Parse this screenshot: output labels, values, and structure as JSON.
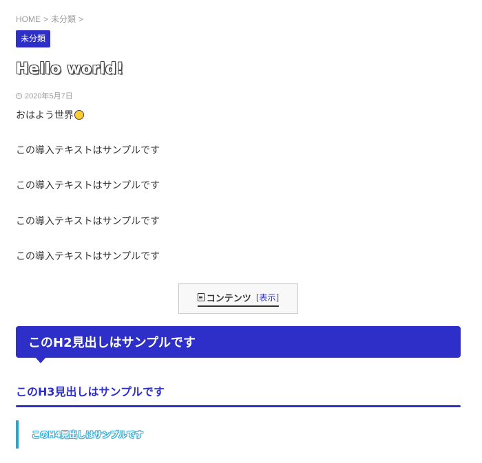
{
  "breadcrumb": {
    "home": "HOME",
    "sep1": ">",
    "category": "未分類",
    "sep2": ">"
  },
  "category_label": "未分類",
  "post": {
    "title": "Hello world!",
    "date": "2020年5月7日",
    "greeting": "おはよう世界",
    "paragraphs": [
      "この導入テキストはサンプルです",
      "この導入テキストはサンプルです",
      "この導入テキストはサンプルです",
      "この導入テキストはサンプルです"
    ]
  },
  "toc": {
    "title": "コンテンツ",
    "toggle_open": "[",
    "toggle_link": "表示",
    "toggle_close": "]"
  },
  "headings": {
    "h2": "このH2見出しはサンプルです",
    "h3": "このH3見出しはサンプルです",
    "h4": "このH4見出しはサンプルです"
  },
  "colors": {
    "accent": "#2d2fc8",
    "h4_accent": "#1fa7d6"
  },
  "icons": {
    "date": "clock-icon",
    "greeting_emoji": "hand-icon",
    "toc": "document-icon"
  }
}
